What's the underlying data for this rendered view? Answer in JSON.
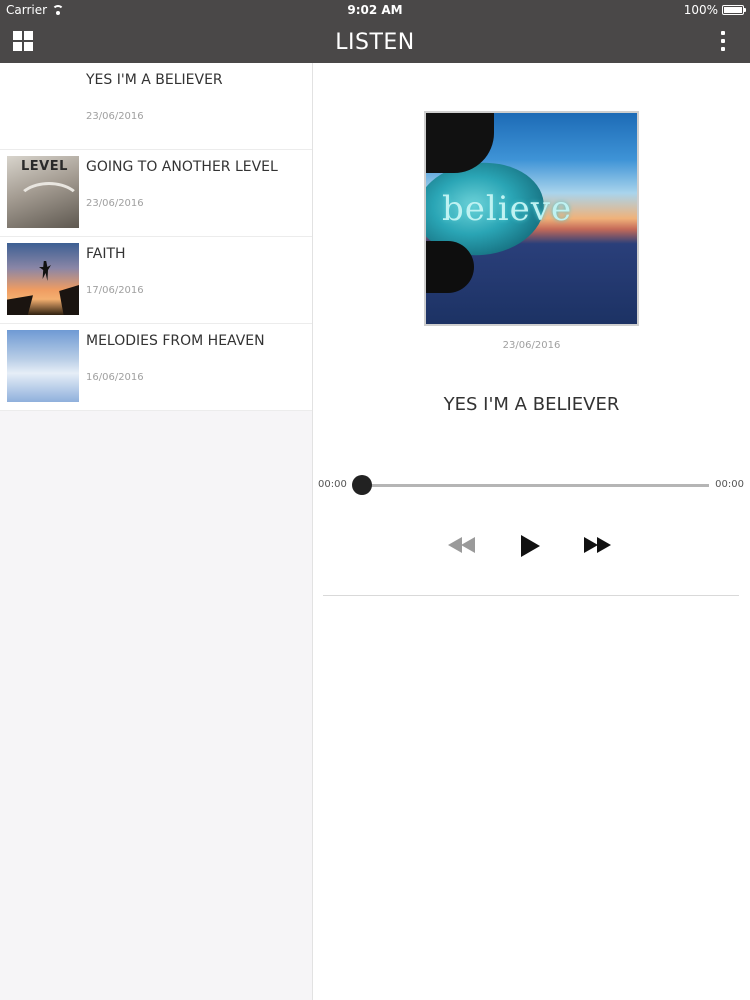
{
  "status_bar": {
    "carrier": "Carrier",
    "time": "9:02 AM",
    "battery": "100%",
    "battery_level": 1.0
  },
  "nav": {
    "title": "LISTEN",
    "left_icon": "grid-icon",
    "right_icon": "more-vertical-icon"
  },
  "tracks": [
    {
      "title": "YES I'M A BELIEVER",
      "date": "23/06/2016"
    },
    {
      "title": "GOING TO ANOTHER LEVEL",
      "date": "23/06/2016",
      "thumb_text": "LEVEL"
    },
    {
      "title": "FAITH",
      "date": "17/06/2016"
    },
    {
      "title": "MELODIES FROM HEAVEN",
      "date": "16/06/2016"
    }
  ],
  "player": {
    "cover_text": "believe",
    "date": "23/06/2016",
    "title": "YES I'M A BELIEVER",
    "current_time": "00:00",
    "total_time": "00:00",
    "progress": 0
  },
  "colors": {
    "nav_bg": "#4a4848",
    "list_bg": "#f6f5f7",
    "text": "#333333",
    "muted": "#a0a0a0"
  }
}
